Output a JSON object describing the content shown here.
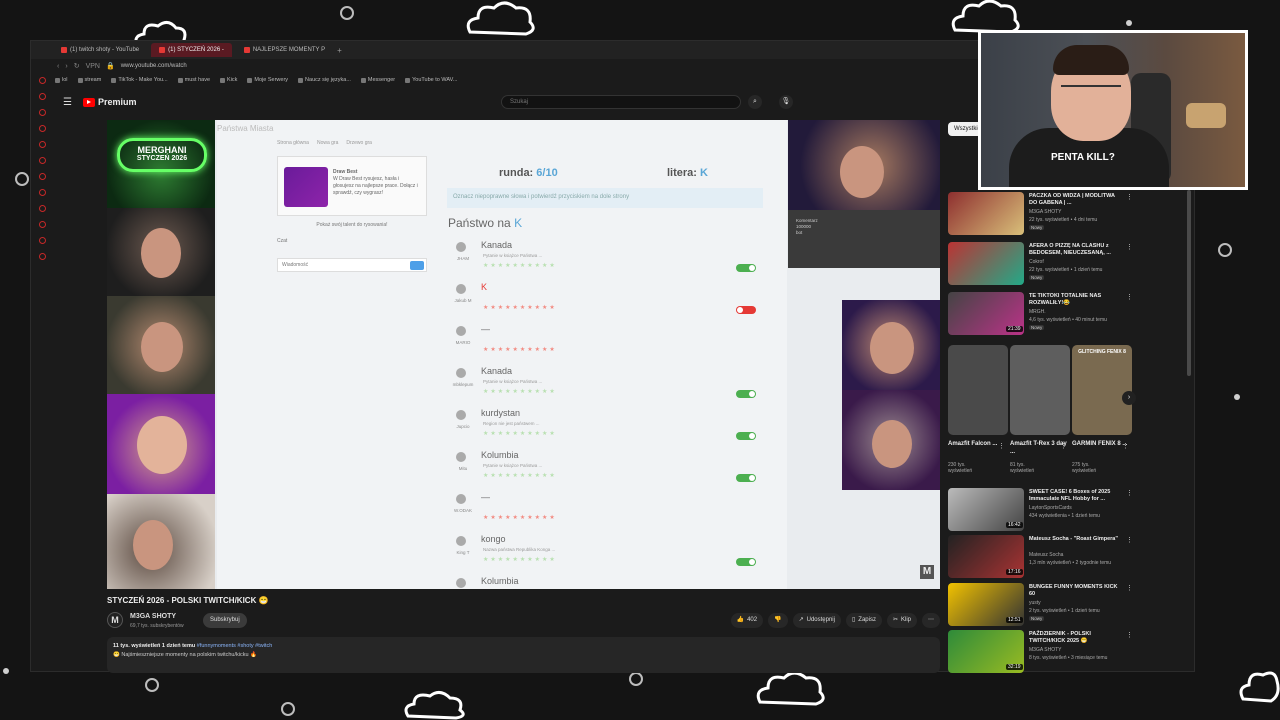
{
  "browser": {
    "tabs": [
      {
        "label": "(1) twitch shoty - YouTube",
        "active": false
      },
      {
        "label": "(1) STYCZEŃ 2026 -",
        "active": true
      },
      {
        "label": "NAJLEPSZE MOMENTY P",
        "active": false
      }
    ],
    "new_tab": "+",
    "url": "www.youtube.com/watch",
    "vpn": "VPN",
    "bookmarks": [
      "lol",
      "stream",
      "TikTok - Make You...",
      "must have",
      "Kick",
      "Moje Serwery",
      "Naucz się języka...",
      "Messenger",
      "YouTube to WAV..."
    ]
  },
  "youtube": {
    "logo": "Premium",
    "logo_sup": "PL",
    "search_placeholder": "Szukaj"
  },
  "video": {
    "game_title": "Państwa Miasta",
    "links": [
      "Strona główna",
      "Nowa gra",
      "Drzewo gra"
    ],
    "card_title": "Draw Best",
    "card_text": "W Draw Best rysujesz, hasła i głosujesz na najlepsze prace. Dołącz i sprawdź, czy wygrasz!",
    "promo": "Pokaż swój talent do rysowania!",
    "chat_label": "Czat",
    "chat_placeholder": "Wiadomość",
    "runda_label": "runda:",
    "runda_value": "6/10",
    "litera_label": "litera:",
    "litera_value": "K",
    "info": "Oznacz niepoprawne słowa i potwierdź przyciskiem na dole strony",
    "category_label": "Państwo na",
    "category_letter": "K",
    "answers": [
      {
        "player": "JHAM",
        "word": "Kanada",
        "note": "Pytanie w książce Państwa ...",
        "ok": true,
        "red": false
      },
      {
        "player": "Jakub M",
        "word": "K",
        "note": "",
        "ok": false,
        "red": true
      },
      {
        "player": "MARIO",
        "word": "—",
        "note": "",
        "ok": null,
        "red": true
      },
      {
        "player": "mbklepum",
        "word": "Kanada",
        "note": "Pytanie w książce Państwa ...",
        "ok": true,
        "red": false
      },
      {
        "player": "Jupcio",
        "word": "kurdystan",
        "note": "Region nie jest państwem ...",
        "ok": true,
        "red": false
      },
      {
        "player": "Mitu",
        "word": "Kolumbia",
        "note": "Pytanie w książce Państwa ...",
        "ok": true,
        "red": false
      },
      {
        "player": "W.ODAK",
        "word": "—",
        "note": "",
        "ok": null,
        "red": true
      },
      {
        "player": "King T",
        "word": "kongo",
        "note": "Nazwa państwa Republika Konga ...",
        "ok": true,
        "red": false
      },
      {
        "player": "Ali",
        "word": "Kolumbia",
        "note": "Pytanie w książce Państwa ...",
        "ok": null,
        "red": false
      }
    ],
    "overlay_name": "MERGHANI",
    "overlay_date": "STYCZEŃ 2026",
    "cam7_lines": [
      "Komentarz",
      "100000",
      "bot"
    ],
    "watermark": "M"
  },
  "below": {
    "title": "STYCZEŃ 2026 - POLSKI TWITCH/KICK 😁",
    "channel": "M3GA SHOTY",
    "channel_avatar": "M",
    "subs": "69,7 tys. subskrybentów",
    "subscribe": "Subskrybuj",
    "likes": "402",
    "share": "Udostępnij",
    "save": "Zapisz",
    "clip": "Klip",
    "more": "⋯",
    "meta": "11 tys. wyświetleń  1 dzień temu",
    "tags": "#funnymoments #shoty #twitch",
    "desc": "😁 Najśmieszniejsze momenty na polskim twitchu/kicku 🔥"
  },
  "recs": {
    "chip": "Wszystkie",
    "items": [
      {
        "title": "PACZKA OD WIDZA | MODLITWA DO GABENA | ...",
        "channel": "M3GA SHOTY",
        "views": "22 tys. wyświetleń • 4 dni temu",
        "badge": "Nowy",
        "duration": "",
        "color1": "#8e2f2f",
        "color2": "#d9c07a"
      },
      {
        "title": "AFERA O PIZZĘ NA CLASHU z BEDOESEM, NIEUCZESANĄ, ...",
        "channel": "Cokrof",
        "views": "22 tys. wyświetleń • 1 dzień temu",
        "badge": "Nowy",
        "duration": "",
        "color1": "#b33",
        "color2": "#2a8"
      },
      {
        "title": "TE TIKTOKI TOTALNIE NAS ROZWALIŁY!😂",
        "channel": "MRGH.",
        "views": "4,6 tys. wyświetleń • 40 minut temu",
        "badge": "Nowy",
        "duration": "21:39",
        "color1": "#444",
        "color2": "#b38"
      },
      {
        "title": "SWEET CASE! 6 Boxes of 2025 Immaculate NFL Hobby for ...",
        "channel": "LaytonSportsCards",
        "views": "434 wyświetlenia • 1 dzień temu",
        "badge": "",
        "duration": "16:42",
        "color1": "#bbb",
        "color2": "#444"
      },
      {
        "title": "Mateusz Socha - \"Roast Gimpera\"",
        "channel": "Mateusz Socha",
        "views": "1,3 mln wyświetleń • 2 tygodnie temu",
        "badge": "",
        "duration": "17:16",
        "color1": "#222",
        "color2": "#a33"
      },
      {
        "title": "BUNGEE FUNNY MOMENTS KICK 60",
        "channel": "yusty",
        "views": "2 tys. wyświetleń • 1 dzień temu",
        "badge": "Nowy",
        "duration": "12:51",
        "color1": "#f2c200",
        "color2": "#333"
      },
      {
        "title": "PAŹDZIERNIK - POLSKI TWITCH/KICK 2025 😁",
        "channel": "M3GA SHOTY",
        "views": "8 tys. wyświetleń • 3 miesiące temu",
        "badge": "",
        "duration": "32:19",
        "color1": "#2e8b3a",
        "color2": "#9b2"
      }
    ],
    "shorts": [
      {
        "title": "Amazfit Falcon ...",
        "views": "230 tys. wyświetleń",
        "color": "#555"
      },
      {
        "title": "Amazfit T-Rex 3 day ...",
        "views": "81 tys. wyświetleń",
        "color": "#666"
      },
      {
        "title": "GARMIN FENIX 8 ...",
        "views": "275 tys. wyświetleń",
        "color": "#7a6a50"
      }
    ],
    "shorts_overlay": "GLITCHING FENIX 8",
    "next": "›"
  },
  "facecam": {
    "shirt_text": "PENTA KILL?"
  }
}
